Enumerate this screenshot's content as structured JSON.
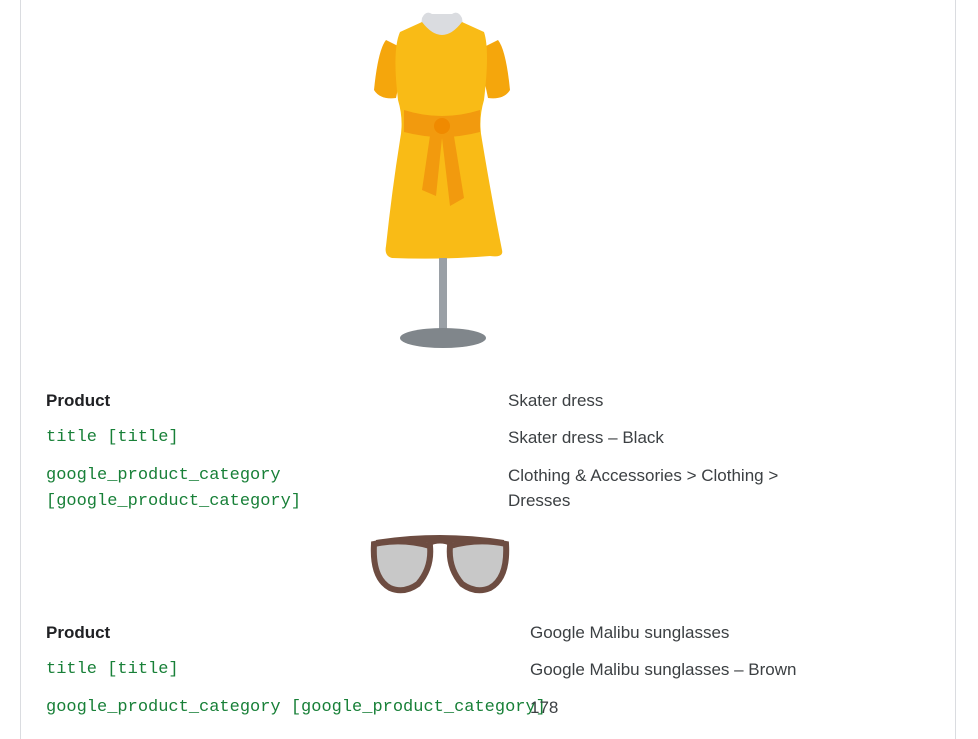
{
  "colors": {
    "code_text": "#188038",
    "body_text": "#3c4043",
    "label_text": "#202124",
    "dress_yellow": "#f9bb16",
    "dress_sash": "#f29a0e",
    "mannequin_gray": "#9aa0a6",
    "sunglasses_frame": "#6d4c41",
    "sunglasses_lens": "#c8c8c8"
  },
  "products": [
    {
      "image_icon": "dress-on-mannequin-icon",
      "rows": [
        {
          "attribute": "Product",
          "value": "Skater dress"
        },
        {
          "attribute": "title [title]",
          "value": "Skater dress – Black"
        },
        {
          "attribute_line1": "google_product_category",
          "attribute_line2": "[google_product_category]",
          "value_line1": "Clothing & Accessories > Clothing >",
          "value_line2": "Dresses"
        }
      ]
    },
    {
      "image_icon": "sunglasses-icon",
      "rows": [
        {
          "attribute": "Product",
          "value": "Google Malibu sunglasses"
        },
        {
          "attribute": "title [title]",
          "value": "Google Malibu sunglasses – Brown"
        },
        {
          "attribute": "google_product_category [google_product_category]",
          "value": "178"
        }
      ]
    }
  ]
}
